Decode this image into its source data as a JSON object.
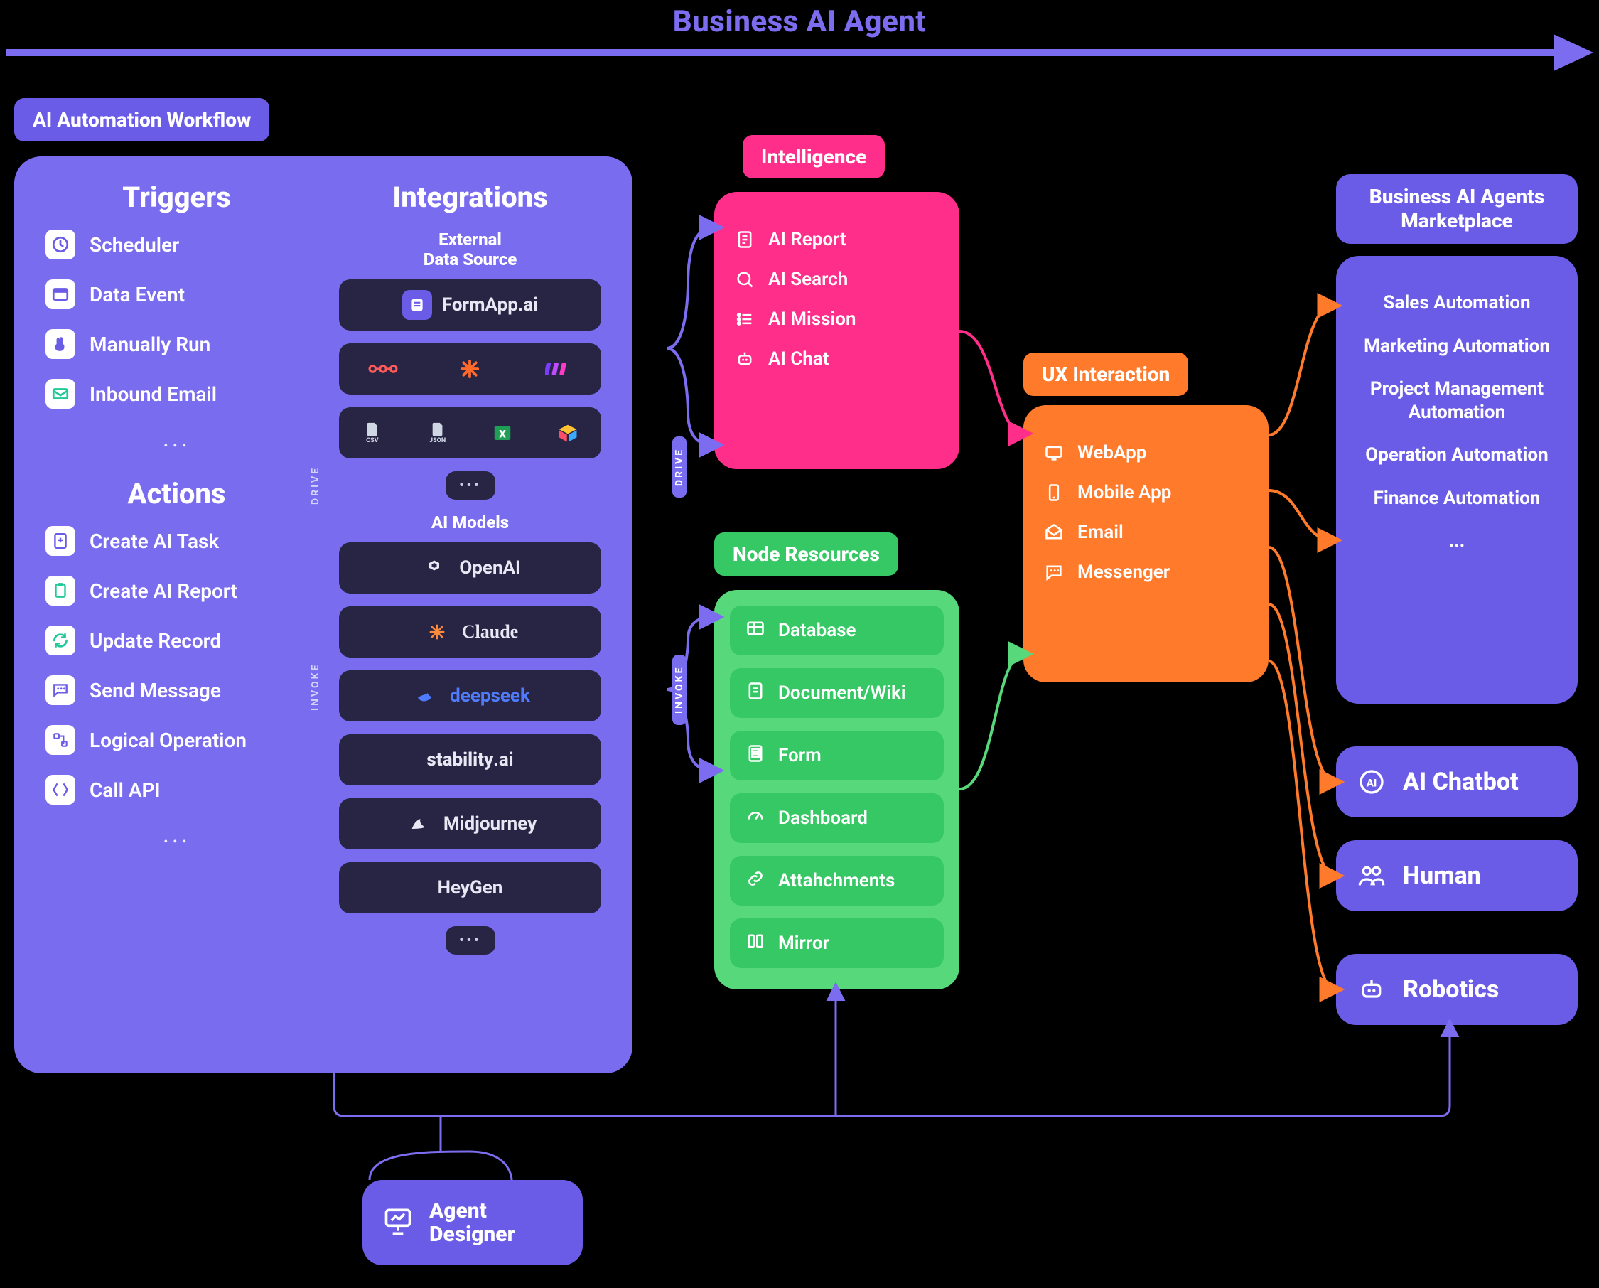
{
  "title": "Business AI Agent",
  "colors": {
    "purple": "#6b5ce7",
    "panel_purple": "#7a6cef",
    "pink": "#ff2e8a",
    "green_panel": "#57d87b",
    "green_pill": "#35c864",
    "orange": "#ff7a2a",
    "dark_pill": "#272543"
  },
  "workflow": {
    "chip": "AI Automation Workflow",
    "triggers_title": "Triggers",
    "triggers": [
      {
        "icon": "clock-icon",
        "label": "Scheduler"
      },
      {
        "icon": "data-event-icon",
        "label": "Data Event"
      },
      {
        "icon": "hand-icon",
        "label": "Manually Run"
      },
      {
        "icon": "mail-icon",
        "label": "Inbound Email"
      }
    ],
    "triggers_more": "...",
    "actions_title": "Actions",
    "actions": [
      {
        "icon": "plus-doc-icon",
        "label": "Create AI Task"
      },
      {
        "icon": "clipboard-icon",
        "label": "Create AI Report"
      },
      {
        "icon": "refresh-icon",
        "label": "Update Record"
      },
      {
        "icon": "chat-icon",
        "label": "Send Message"
      },
      {
        "icon": "flow-icon",
        "label": "Logical Operation"
      },
      {
        "icon": "api-icon",
        "label": "Call API"
      }
    ],
    "actions_more": "...",
    "integrations_title": "Integrations",
    "ext_title_1": "External",
    "ext_title_2": "Data Source",
    "ext_primary": "FormApp.ai",
    "ext_row2": [
      "n8n-icon",
      "zapier-icon",
      "make-icon"
    ],
    "ext_row3": [
      "csv-icon",
      "json-icon",
      "excel-icon",
      "airtable-icon"
    ],
    "models_title": "AI Models",
    "models": [
      "OpenAI",
      "Claude",
      "deepseek",
      "stability.ai",
      "Midjourney",
      "HeyGen"
    ],
    "more_dots": "•••",
    "side_drive": "DRIVE",
    "side_invoke": "INVOKE"
  },
  "intelligence": {
    "chip": "Intelligence",
    "items": [
      {
        "icon": "report-icon",
        "label": "AI Report"
      },
      {
        "icon": "search-icon",
        "label": "AI Search"
      },
      {
        "icon": "list-icon",
        "label": "AI Mission"
      },
      {
        "icon": "robot-icon",
        "label": "AI Chat"
      }
    ]
  },
  "node": {
    "chip": "Node Resources",
    "items": [
      {
        "icon": "table-icon",
        "label": "Database"
      },
      {
        "icon": "doc-icon",
        "label": "Document/Wiki"
      },
      {
        "icon": "form-icon",
        "label": "Form"
      },
      {
        "icon": "gauge-icon",
        "label": "Dashboard"
      },
      {
        "icon": "link-icon",
        "label": "Attahchments"
      },
      {
        "icon": "mirror-icon",
        "label": "Mirror"
      }
    ],
    "side_drive": "DRIVE",
    "side_invoke": "INVOKE"
  },
  "ux": {
    "chip": "UX Interaction",
    "items": [
      {
        "icon": "monitor-icon",
        "label": "WebApp"
      },
      {
        "icon": "phone-icon",
        "label": "Mobile App"
      },
      {
        "icon": "mail-open-icon",
        "label": "Email"
      },
      {
        "icon": "messenger-icon",
        "label": "Messenger"
      }
    ]
  },
  "marketplace": {
    "chip": "Business AI Agents Marketplace",
    "items": [
      "Sales Automation",
      "Marketing Automation",
      "Project Management Automation",
      "Operation Automation",
      "Finance Automation"
    ],
    "more": "..."
  },
  "right": {
    "chatbot": {
      "icon": "ai-circle-icon",
      "label": "AI Chatbot"
    },
    "human": {
      "icon": "people-icon",
      "label": "Human"
    },
    "robotics": {
      "icon": "robot-head-icon",
      "label": "Robotics"
    }
  },
  "agent_designer": {
    "icon": "presentation-icon",
    "label1": "Agent",
    "label2": "Designer"
  }
}
